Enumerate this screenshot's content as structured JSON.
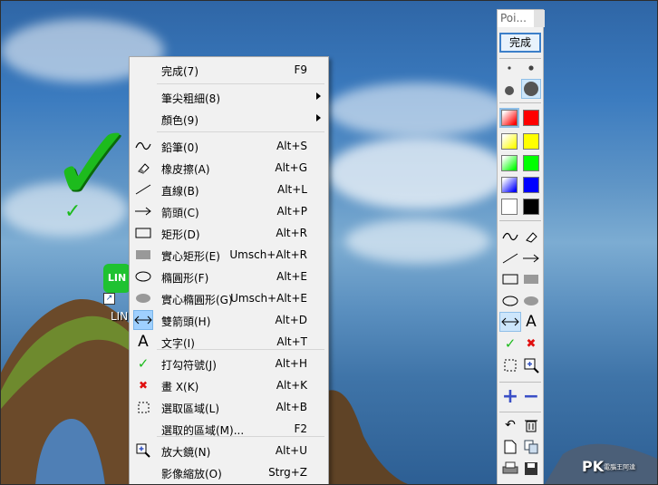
{
  "colors": {
    "menu_bg": "#f1f1f1",
    "highlight": "#9fd0ff",
    "check_green": "#1dbb1d",
    "red_x": "#e01010",
    "palette_accent": "#3c7fc9"
  },
  "desktop": {
    "shortcut_label": "LIN",
    "icon_text": "LIN"
  },
  "menu": {
    "items": [
      {
        "label": "完成(7)",
        "shortcut": "F9",
        "icon": "none"
      },
      {
        "label": "筆尖粗細(8)",
        "shortcut": "",
        "icon": "none",
        "submenu": true
      },
      {
        "label": "顏色(9)",
        "shortcut": "",
        "icon": "none",
        "submenu": true
      },
      {
        "label": "鉛筆(0)",
        "shortcut": "Alt+S",
        "icon": "pencil-icon"
      },
      {
        "label": "橡皮擦(A)",
        "shortcut": "Alt+G",
        "icon": "eraser-icon"
      },
      {
        "label": "直線(B)",
        "shortcut": "Alt+L",
        "icon": "line-icon"
      },
      {
        "label": "箭頭(C)",
        "shortcut": "Alt+P",
        "icon": "arrow-icon"
      },
      {
        "label": "矩形(D)",
        "shortcut": "Alt+R",
        "icon": "rectangle-icon"
      },
      {
        "label": "實心矩形(E)",
        "shortcut": "Umsch+Alt+R",
        "icon": "filled-rectangle-icon"
      },
      {
        "label": "橢圓形(F)",
        "shortcut": "Alt+E",
        "icon": "ellipse-icon"
      },
      {
        "label": "實心橢圓形(G)",
        "shortcut": "Umsch+Alt+E",
        "icon": "filled-ellipse-icon"
      },
      {
        "label": "雙箭頭(H)",
        "shortcut": "Alt+D",
        "icon": "double-arrow-icon"
      },
      {
        "label": "文字(I)",
        "shortcut": "Alt+T",
        "icon": "text-icon"
      },
      {
        "label": "打勾符號(J)",
        "shortcut": "Alt+H",
        "icon": "checkmark-icon"
      },
      {
        "label": "畫 X(K)",
        "shortcut": "Alt+K",
        "icon": "x-mark-icon"
      },
      {
        "label": "選取區域(L)",
        "shortcut": "Alt+B",
        "icon": "select-region-icon"
      },
      {
        "label": "選取的區域(M)...",
        "shortcut": "F2",
        "icon": "none"
      },
      {
        "label": "放大鏡(N)",
        "shortcut": "Alt+U",
        "icon": "magnifier-icon"
      },
      {
        "label": "影像縮放(O)",
        "shortcut": "Strg+Z",
        "icon": "none"
      }
    ]
  },
  "palette": {
    "title": "Poi...",
    "done_label": "完成",
    "swatches": [
      "#ffffff",
      "#ff0000",
      "#ffff00",
      "#ffff00",
      "#00ff00",
      "#00ff00",
      "#0000ff",
      "#0000ff",
      "#ffffff",
      "#000000"
    ]
  },
  "watermark": {
    "main": "PK",
    "small": "電腦王阿達"
  }
}
